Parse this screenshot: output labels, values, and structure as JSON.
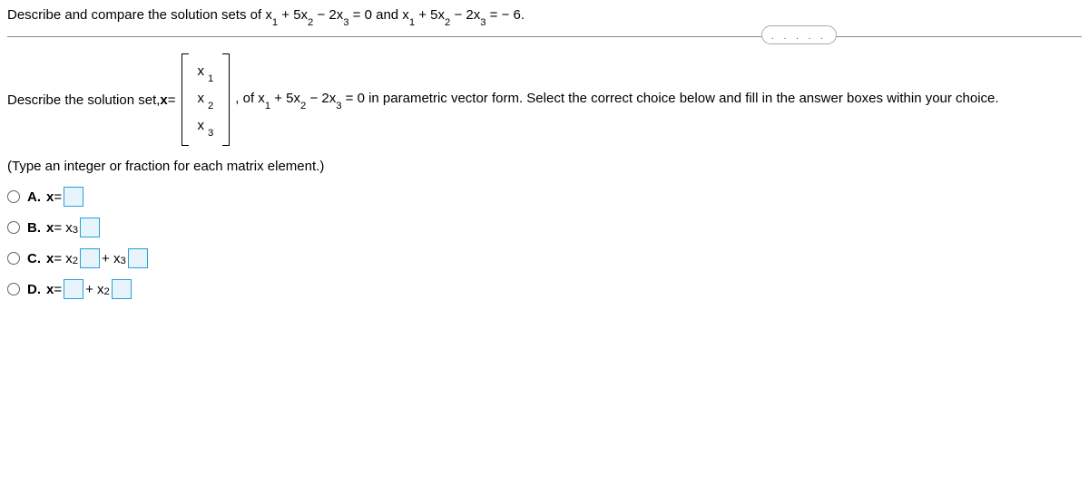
{
  "header": {
    "text_before": "Describe and compare the solution sets of x",
    "eq1_part1": " + 5x",
    "eq1_part2": " − 2x",
    "eq1_part3": " = 0 and x",
    "eq2_part1": " + 5x",
    "eq2_part2": " − 2x",
    "eq2_part3": " = − 6.",
    "dots": ". . . . ."
  },
  "describe": {
    "prefix": "Describe the solution set, ",
    "x_eq": "x",
    "equals": " = ",
    "matrix": {
      "r1": "x",
      "r1_sub": "1",
      "r2": "x",
      "r2_sub": "2",
      "r3": "x",
      "r3_sub": "3"
    },
    "comma_of": ", of x",
    "eq_part1": " + 5x",
    "eq_part2": " − 2x",
    "eq_part3": " = 0 in parametric vector form. Select the correct choice below and fill in the answer boxes within your choice."
  },
  "instruction": "(Type an integer or fraction for each matrix element.)",
  "choices": {
    "a": {
      "label": "A.",
      "text1": "x",
      "text2": " = "
    },
    "b": {
      "label": "B.",
      "text1": "x",
      "text2": " = x",
      "sub1": "3"
    },
    "c": {
      "label": "C.",
      "text1": "x",
      "text2": " = x",
      "sub1": "2",
      "plus": " + x",
      "sub2": "3"
    },
    "d": {
      "label": "D.",
      "text1": "x",
      "text2": " = ",
      "plus": " + x",
      "sub1": "2"
    }
  },
  "subs": {
    "s1": "1",
    "s2": "2",
    "s3": "3"
  }
}
